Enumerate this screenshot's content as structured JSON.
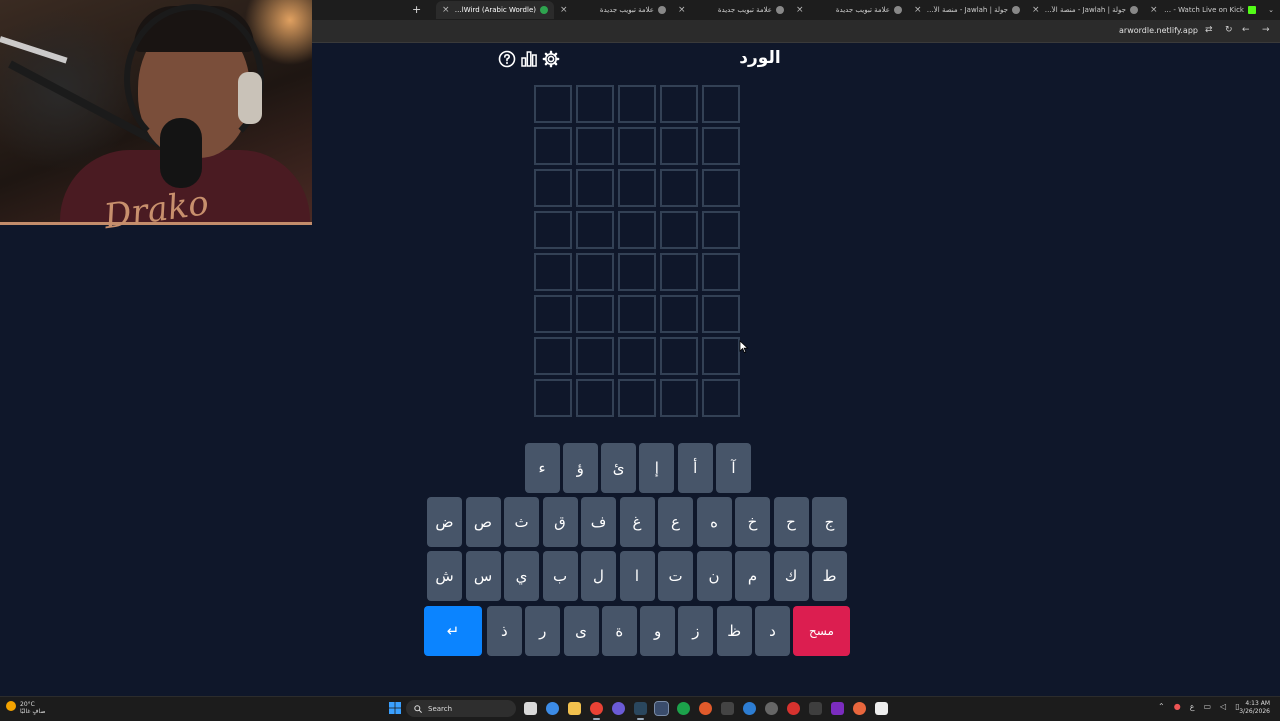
{
  "browser": {
    "tabs": [
      {
        "title": "xdrako0 Stream - Watch Live on Kick",
        "favicon": "kick-icon"
      },
      {
        "title": "جولة | Jawlah - منصة الألعاب ال",
        "favicon": "crown-icon"
      },
      {
        "title": "جولة | Jawlah - منصة الألعاب ال",
        "favicon": "crown-icon"
      },
      {
        "title": "علامة تبويب جديدة",
        "favicon": "chrome-icon"
      },
      {
        "title": "علامة تبويب جديدة",
        "favicon": "chrome-icon"
      },
      {
        "title": "علامة تبويب جديدة",
        "favicon": "chrome-icon"
      },
      {
        "title": "AlWird (Arabic Wordle) - الورد",
        "favicon": "wordle-icon",
        "active": true
      }
    ],
    "url": "arwordle.netlify.app"
  },
  "stream": {
    "signature": "Drako"
  },
  "game": {
    "title": "الورد",
    "rows": 8,
    "cols": 5,
    "keyboard": {
      "row1": [
        "آ",
        "أ",
        "إ",
        "ئ",
        "ؤ",
        "ء"
      ],
      "row2": [
        "ج",
        "ح",
        "خ",
        "ه",
        "ع",
        "غ",
        "ف",
        "ق",
        "ث",
        "ص",
        "ض"
      ],
      "row3": [
        "ط",
        "ك",
        "م",
        "ن",
        "ت",
        "ا",
        "ل",
        "ب",
        "ي",
        "س",
        "ش"
      ],
      "row4": {
        "delete": "مسح",
        "letters": [
          "د",
          "ظ",
          "ز",
          "و",
          "ة",
          "ى",
          "ر",
          "ذ"
        ],
        "enter": "↵"
      }
    },
    "colors": {
      "background": "#0f172a",
      "cell_border": "#334155",
      "key": "#475569",
      "enter": "#0b84ff",
      "delete": "#dc1e50"
    }
  },
  "taskbar": {
    "weather": {
      "temp": "20°C",
      "desc": "صافٍ غالبًا"
    },
    "search_placeholder": "Search",
    "lang": "ع",
    "time": "4:13 AM",
    "date": "3/26/2026"
  }
}
